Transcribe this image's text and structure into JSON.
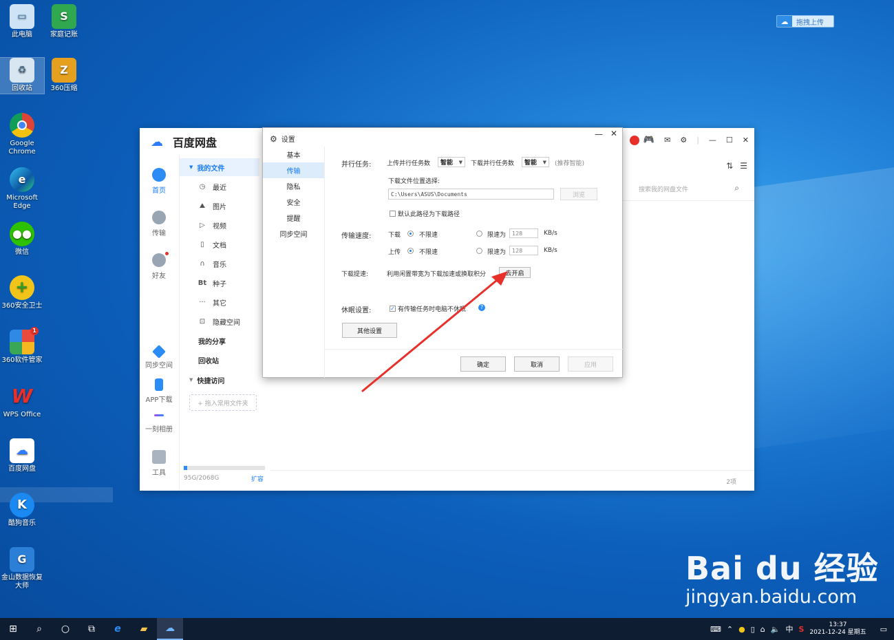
{
  "desktop": {
    "icons": [
      {
        "label": "此电脑"
      },
      {
        "label": "家庭记账"
      },
      {
        "label": "回收站"
      },
      {
        "label": "360压缩"
      },
      {
        "label": "Google Chrome"
      },
      {
        "label": "Microsoft Edge"
      },
      {
        "label": "微信"
      },
      {
        "label": "360安全卫士"
      },
      {
        "label": "360软件管家"
      },
      {
        "label": "WPS Office"
      },
      {
        "label": "百度网盘"
      },
      {
        "label": "酷狗音乐"
      },
      {
        "label": "金山数据恢复大师"
      }
    ],
    "upload_pill": "拖拽上传",
    "badge_360": "1"
  },
  "app": {
    "brand": "百度网盘",
    "nav": [
      {
        "label": "首页"
      },
      {
        "label": "传输"
      },
      {
        "label": "好友"
      },
      {
        "label": "同步空间"
      },
      {
        "label": "APP下载"
      },
      {
        "label": "一刻相册"
      },
      {
        "label": "工具"
      }
    ],
    "subnav": {
      "my_files": "我的文件",
      "items": [
        {
          "label": "最近",
          "icon": "◷"
        },
        {
          "label": "图片",
          "icon": "⛰"
        },
        {
          "label": "视频",
          "icon": "▷"
        },
        {
          "label": "文档",
          "icon": "▯"
        },
        {
          "label": "音乐",
          "icon": "∩"
        },
        {
          "label": "种子",
          "icon": "Bt"
        },
        {
          "label": "其它",
          "icon": "···"
        },
        {
          "label": "隐藏空间",
          "icon": "⊡"
        }
      ],
      "my_share": "我的分享",
      "recycle": "回收站",
      "quick_access": "快捷访问",
      "drop_hint": "+ 拖入常用文件夹"
    },
    "storage": {
      "text": "95G/2068G",
      "expand": "扩容",
      "used_fraction": 0.046
    },
    "search_placeholder": "搜索我的网盘文件",
    "item_count": "2项"
  },
  "settings": {
    "title": "设置",
    "tabs": [
      "基本",
      "传输",
      "隐私",
      "安全",
      "提醒",
      "同步空间"
    ],
    "active_tab": "传输",
    "parallel_label": "并行任务:",
    "upload_parallel": "上传并行任务数",
    "upload_value": "智能",
    "download_parallel": "下载并行任务数",
    "download_value": "智能",
    "recommend": "(推荐智能)",
    "download_location": "下载文件位置选择:",
    "path": "C:\\Users\\ASUS\\Documents",
    "browse": "浏览",
    "default_path": "默认此路径为下载路径",
    "speed_label": "传输速度:",
    "download": "下载",
    "upload": "上传",
    "unlimited": "不限速",
    "limit_to": "限速为",
    "limit_value": "128",
    "unit": "KB/s",
    "accel_label": "下载提速:",
    "accel_text": "利用闲置带宽为下载加速或换取积分",
    "accel_button": "去开启",
    "sleep_label": "休眠设置:",
    "sleep_text": "有传输任务时电脑不休眠",
    "other_settings": "其他设置",
    "ok": "确定",
    "cancel": "取消",
    "apply": "应用"
  },
  "taskbar": {
    "ime": "中",
    "time": "13:37",
    "date": "2021-12-24 星期五"
  },
  "watermark": {
    "brand": "Bai du 经验",
    "url": "jingyan.baidu.com"
  },
  "colors": {
    "accent": "#1a7cf5",
    "arrow": "#e8302a",
    "taskbar": "#0f1d33"
  }
}
